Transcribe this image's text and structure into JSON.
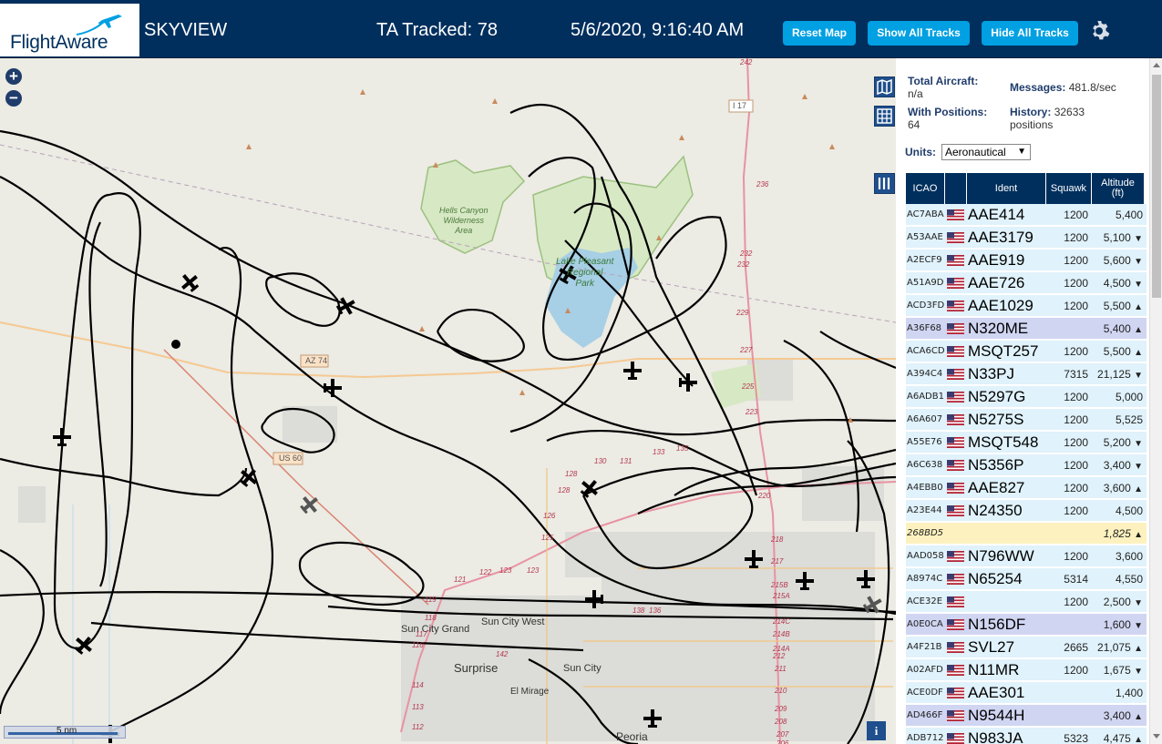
{
  "header": {
    "brand": "FlightAware",
    "app_title": "SKYVIEW",
    "tracked": "TA Tracked: 78",
    "datetime": "5/6/2020, 9:16:40 AM",
    "buttons": {
      "reset_map": "Reset Map",
      "show_all_tracks": "Show All Tracks",
      "hide_all_tracks": "Hide All Tracks"
    },
    "settings_icon": "gear-icon"
  },
  "map": {
    "zoom_in": "+",
    "zoom_out": "−",
    "scale_label": "5 nm",
    "info_label": "i",
    "labels": {
      "hells_canyon": [
        "Hells Canyon",
        "Wilderness",
        "Area"
      ],
      "lake_pleasant": [
        "Lake Pleasant",
        "Regional",
        "Park"
      ],
      "az74": "AZ 74",
      "us60": "US 60",
      "i17": "I 17",
      "sun_city_grand": "Sun City Grand",
      "sun_city_west": "Sun City West",
      "sun_city": "Sun City",
      "surprise": "Surprise",
      "el_mirage": "El Mirage",
      "peoria": "Peoria"
    },
    "exit_numbers": [
      "242",
      "236",
      "232",
      "232",
      "229",
      "227",
      "225",
      "223",
      "220",
      "218",
      "217",
      "215B",
      "215A",
      "214C",
      "214B",
      "214A",
      "212",
      "211",
      "210",
      "209",
      "208",
      "207",
      "206",
      "131",
      "133",
      "135",
      "130",
      "128",
      "128",
      "126",
      "125",
      "123",
      "123",
      "122",
      "121",
      "119",
      "118",
      "117",
      "116",
      "114",
      "113",
      "112",
      "142",
      "136",
      "138"
    ],
    "colors": {
      "land": "#ecebe4",
      "park": "#d7e8c4",
      "water": "#a7cfe5",
      "track": "#000000",
      "interstate": "#e892a2",
      "highway": "#f5c992"
    }
  },
  "sidebar": {
    "total_aircraft_label": "Total Aircraft:",
    "total_aircraft_value": "n/a",
    "with_positions_label": "With Positions:",
    "with_positions_value": "64",
    "messages_label": "Messages:",
    "messages_value": "481.8/sec",
    "history_label": "History:",
    "history_value": "32633",
    "history_unit": "positions",
    "units_label": "Units:",
    "units_value": "Aeronautical",
    "columns": [
      "ICAO",
      "",
      "Ident",
      "Squawk",
      "Altitude (ft)"
    ],
    "rows": [
      {
        "icao": "AC7ABA",
        "flag": true,
        "ident": "AAE414",
        "squawk": "1200",
        "altitude": "5,400",
        "trend": "",
        "bg": "#e0f2fb"
      },
      {
        "icao": "A53AAE",
        "flag": true,
        "ident": "AAE3179",
        "squawk": "1200",
        "altitude": "5,100",
        "trend": "▼",
        "bg": "#e0f2fb"
      },
      {
        "icao": "A2ECF9",
        "flag": true,
        "ident": "AAE919",
        "squawk": "1200",
        "altitude": "5,600",
        "trend": "▼",
        "bg": "#e0f2fb"
      },
      {
        "icao": "A51A9D",
        "flag": true,
        "ident": "AAE726",
        "squawk": "1200",
        "altitude": "4,500",
        "trend": "▼",
        "bg": "#e0f2fb"
      },
      {
        "icao": "ACD3FD",
        "flag": true,
        "ident": "AAE1029",
        "squawk": "1200",
        "altitude": "5,500",
        "trend": "▲",
        "bg": "#e0f2fb"
      },
      {
        "icao": "A36F68",
        "flag": true,
        "ident": "N320ME",
        "squawk": "",
        "altitude": "5,400",
        "trend": "▲",
        "bg": "#d0d5f2"
      },
      {
        "icao": "ACA6CD",
        "flag": true,
        "ident": "MSQT257",
        "squawk": "1200",
        "altitude": "5,500",
        "trend": "▲",
        "bg": "#e0f2fb"
      },
      {
        "icao": "A394C4",
        "flag": true,
        "ident": "N33PJ",
        "squawk": "7315",
        "altitude": "21,125",
        "trend": "▼",
        "bg": "#e0f2fb"
      },
      {
        "icao": "A6ADB1",
        "flag": true,
        "ident": "N5297G",
        "squawk": "1200",
        "altitude": "5,000",
        "trend": "",
        "bg": "#e0f2fb"
      },
      {
        "icao": "A6A607",
        "flag": true,
        "ident": "N5275S",
        "squawk": "1200",
        "altitude": "5,525",
        "trend": "",
        "bg": "#e0f2fb"
      },
      {
        "icao": "A55E76",
        "flag": true,
        "ident": "MSQT548",
        "squawk": "1200",
        "altitude": "5,200",
        "trend": "▼",
        "bg": "#e0f2fb"
      },
      {
        "icao": "A6C638",
        "flag": true,
        "ident": "N5356P",
        "squawk": "1200",
        "altitude": "3,400",
        "trend": "▼",
        "bg": "#e0f2fb"
      },
      {
        "icao": "A4EBB0",
        "flag": true,
        "ident": "AAE827",
        "squawk": "1200",
        "altitude": "3,600",
        "trend": "▲",
        "bg": "#e0f2fb"
      },
      {
        "icao": "A23E44",
        "flag": true,
        "ident": "N24350",
        "squawk": "1200",
        "altitude": "4,500",
        "trend": "",
        "bg": "#e0f2fb"
      },
      {
        "icao": "268BD5",
        "flag": false,
        "ident": "",
        "squawk": "",
        "altitude": "1,825",
        "trend": "▲",
        "bg": "#fdf2bf",
        "italic": true
      },
      {
        "icao": "AAD058",
        "flag": true,
        "ident": "N796WW",
        "squawk": "1200",
        "altitude": "3,600",
        "trend": "",
        "bg": "#e0f2fb"
      },
      {
        "icao": "A8974C",
        "flag": true,
        "ident": "N65254",
        "squawk": "5314",
        "altitude": "4,550",
        "trend": "",
        "bg": "#e0f2fb"
      },
      {
        "icao": "ACE32E",
        "flag": true,
        "ident": "",
        "squawk": "1200",
        "altitude": "2,500",
        "trend": "▼",
        "bg": "#e0f2fb"
      },
      {
        "icao": "A0E0CA",
        "flag": true,
        "ident": "N156DF",
        "squawk": "",
        "altitude": "1,600",
        "trend": "▼",
        "bg": "#d0d5f2"
      },
      {
        "icao": "A4F21B",
        "flag": true,
        "ident": "SVL27",
        "squawk": "2665",
        "altitude": "21,075",
        "trend": "▲",
        "bg": "#e0f2fb"
      },
      {
        "icao": "A02AFD",
        "flag": true,
        "ident": "N11MR",
        "squawk": "1200",
        "altitude": "1,675",
        "trend": "▼",
        "bg": "#e0f2fb"
      },
      {
        "icao": "ACE0DF",
        "flag": true,
        "ident": "AAE301",
        "squawk": "",
        "altitude": "1,400",
        "trend": "",
        "bg": "#e0f2fb"
      },
      {
        "icao": "AD466F",
        "flag": true,
        "ident": "N9544H",
        "squawk": "",
        "altitude": "3,400",
        "trend": "▲",
        "bg": "#d0d5f2"
      },
      {
        "icao": "ADB712",
        "flag": true,
        "ident": "N983JA",
        "squawk": "5323",
        "altitude": "4,475",
        "trend": "▲",
        "bg": "#e0f2fb"
      }
    ]
  }
}
